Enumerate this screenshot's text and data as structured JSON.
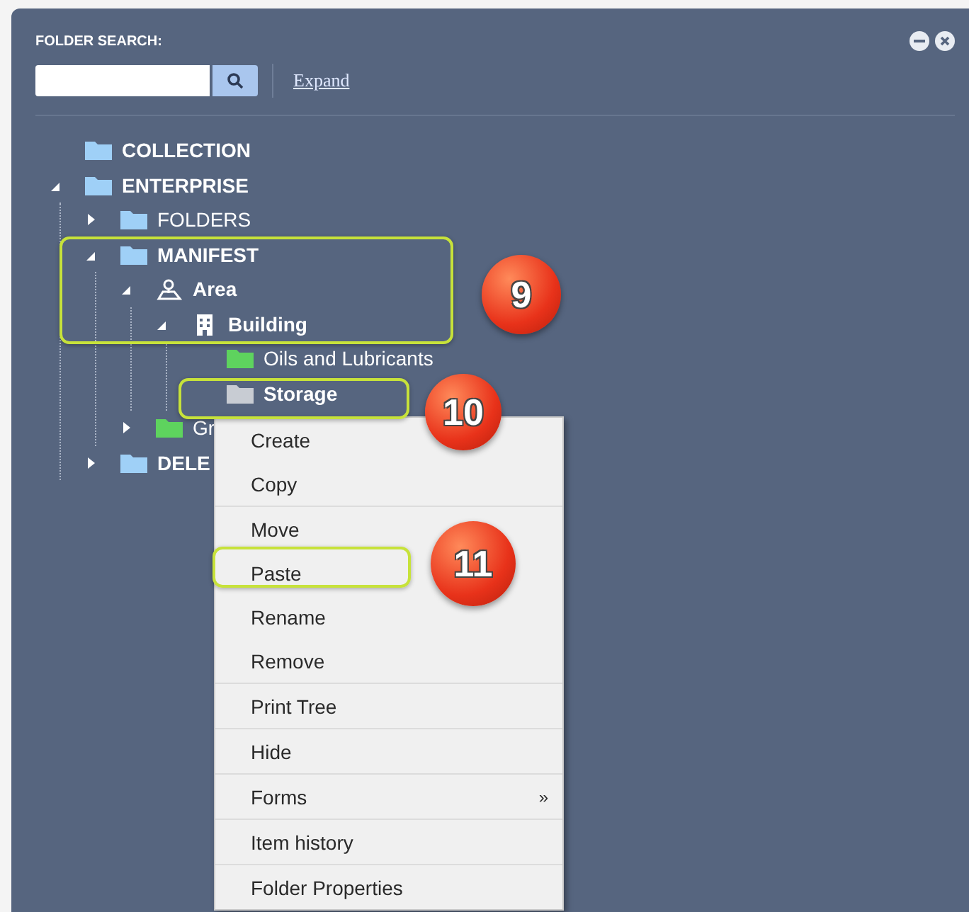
{
  "panel": {
    "title": "FOLDER SEARCH:",
    "expand_link": "Expand"
  },
  "tree": [
    {
      "label": "COLLECTION",
      "kind": "folder",
      "color": "#9fd0f7",
      "bold": true
    },
    {
      "label": "ENTERPRISE",
      "kind": "folder",
      "color": "#9fd0f7",
      "bold": true,
      "expanded": true,
      "children": [
        {
          "label": "FOLDERS",
          "kind": "folder",
          "color": "#9fd0f7",
          "bold": false,
          "expanded": false
        },
        {
          "label": "MANIFEST",
          "kind": "folder",
          "color": "#9fd0f7",
          "bold": true,
          "expanded": true,
          "children": [
            {
              "label": "Area",
              "kind": "area",
              "bold": true,
              "expanded": true,
              "children": [
                {
                  "label": "Building",
                  "kind": "building",
                  "bold": true,
                  "expanded": true,
                  "children": [
                    {
                      "label": "Oils and Lubricants",
                      "kind": "folder",
                      "color": "#5ed35e",
                      "bold": false
                    },
                    {
                      "label": "Storage",
                      "kind": "folder",
                      "color": "#c8ccd3",
                      "bold": true
                    }
                  ]
                }
              ]
            },
            {
              "label": "Gr",
              "kind": "folder",
              "color": "#5ed35e",
              "bold": false,
              "expanded": false
            }
          ]
        },
        {
          "label": "DELE",
          "kind": "folder",
          "color": "#9fd0f7",
          "bold": true,
          "expanded": false
        }
      ]
    }
  ],
  "context_menu": {
    "groups": [
      [
        {
          "label": "Create"
        },
        {
          "label": "Copy"
        }
      ],
      [
        {
          "label": "Move"
        },
        {
          "label": "Paste"
        },
        {
          "label": "Rename"
        },
        {
          "label": "Remove"
        }
      ],
      [
        {
          "label": "Print Tree"
        }
      ],
      [
        {
          "label": "Hide"
        }
      ],
      [
        {
          "label": "Forms",
          "submenu_mark": "»"
        }
      ],
      [
        {
          "label": "Item history"
        }
      ],
      [
        {
          "label": "Folder Properties"
        }
      ]
    ]
  },
  "annotations": [
    {
      "kind": "highlight"
    },
    {
      "kind": "badge",
      "label": "9"
    },
    {
      "kind": "highlight"
    },
    {
      "kind": "badge",
      "label": "10"
    },
    {
      "kind": "highlight"
    },
    {
      "kind": "badge",
      "label": "11"
    }
  ]
}
